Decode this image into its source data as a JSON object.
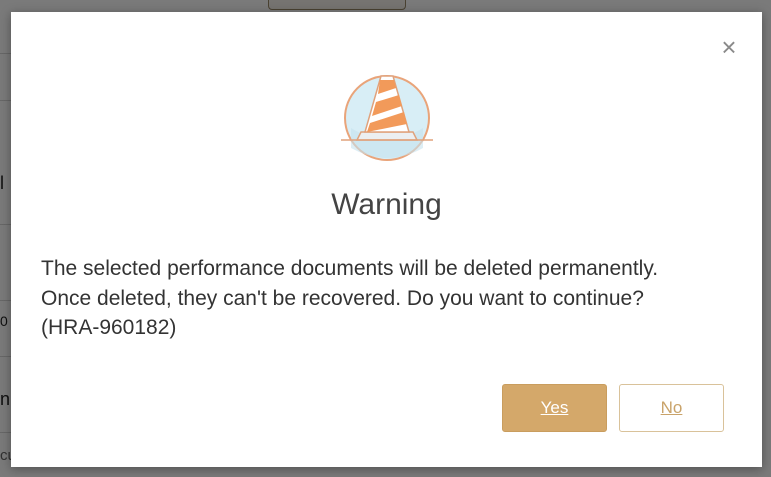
{
  "background": {
    "fragments": [
      "l",
      "0",
      "n",
      "cu"
    ]
  },
  "dialog": {
    "icon": "traffic-cone-icon",
    "title": "Warning",
    "message": "The selected performance documents will be deleted permanently. Once deleted, they can't be recovered. Do you want to continue? (HRA-960182)",
    "close_label": "×",
    "yes_label": "Yes",
    "no_label": "No"
  },
  "colors": {
    "primary": "#d4a86a",
    "cone": "#f29a5a",
    "cone_circle_bg": "#d8eef6"
  }
}
